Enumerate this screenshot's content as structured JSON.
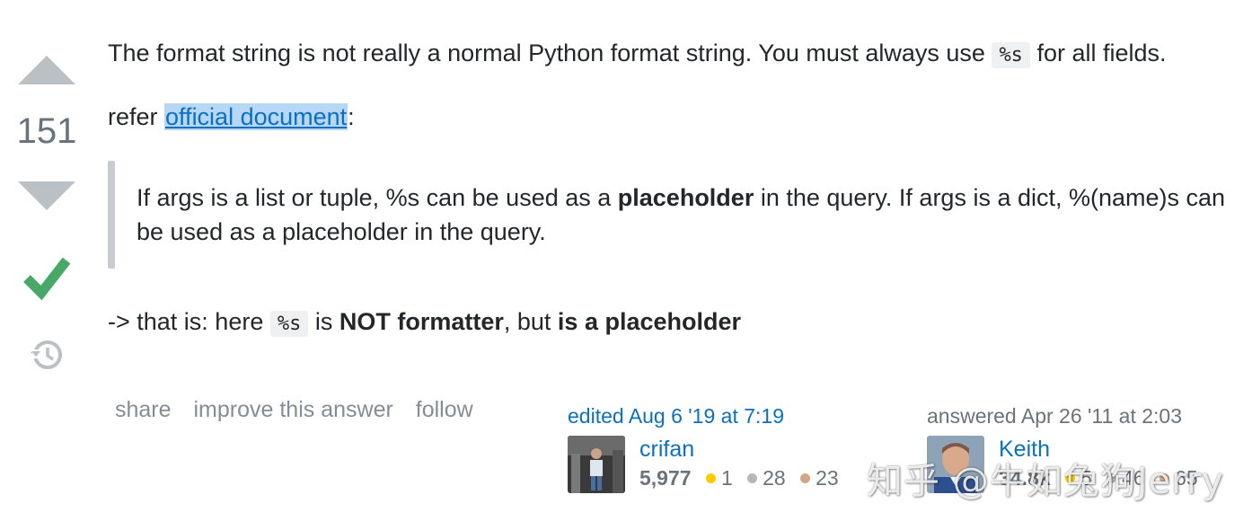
{
  "vote": {
    "count": "151",
    "upvote_icon": "arrow-up-icon",
    "downvote_icon": "arrow-down-icon",
    "accepted_icon": "checkmark-icon",
    "history_icon": "history-icon"
  },
  "post": {
    "p1_a": "The format string is not really a normal Python format string. You must always use ",
    "p1_code": "%s",
    "p1_b": " for all fields.",
    "p2_a": "refer ",
    "p2_link": "official document",
    "p2_b": ":",
    "quote_a": "If args is a list or tuple, %s can be used as a ",
    "quote_bold": "placeholder",
    "quote_b": " in the query. If args is a dict, %(name)s can be used as a placeholder in the query.",
    "p3_a": "-> that is: here ",
    "p3_code": "%s",
    "p3_b": " is ",
    "p3_bold1": "NOT formatter",
    "p3_c": ", but ",
    "p3_bold2": "is a placeholder"
  },
  "menu": {
    "share": "share",
    "improve": "improve this answer",
    "follow": "follow"
  },
  "editor": {
    "action": "edited Aug 6 '19 at 7:19",
    "name": "crifan",
    "reputation": "5,977",
    "gold": "1",
    "silver": "28",
    "bronze": "23"
  },
  "answerer": {
    "action": "answered Apr 26 '11 at 2:03",
    "name": "Keith",
    "reputation": "34.8k",
    "gold": "5",
    "silver": "46",
    "bronze": "65"
  },
  "colors": {
    "gold": "#ffcc01",
    "silver": "#b4b8bc",
    "bronze": "#d1a684",
    "accepted": "#48a868",
    "link": "#0d6fbf"
  },
  "watermark": "知乎 @牛如兔狗Jerry"
}
